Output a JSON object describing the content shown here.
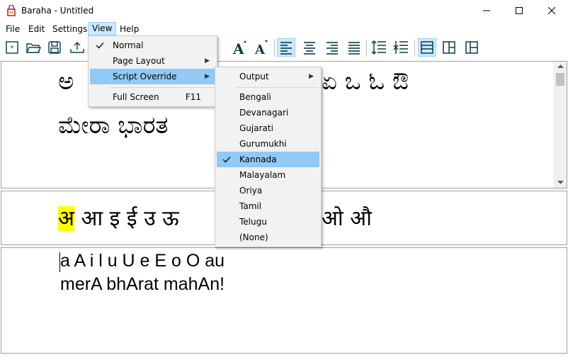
{
  "window": {
    "title": "Baraha - Untitled"
  },
  "menubar": {
    "items": [
      "File",
      "Edit",
      "Settings",
      "View",
      "Help"
    ]
  },
  "view_menu": {
    "items": [
      {
        "label": "Normal",
        "checked": true
      },
      {
        "label": "Page Layout",
        "submenu": true
      },
      {
        "label": "Script Override",
        "submenu": true,
        "highlighted": true
      },
      {
        "label": "Full Screen",
        "shortcut": "F11"
      }
    ]
  },
  "script_menu": {
    "output_label": "Output",
    "items": [
      "Bengali",
      "Devanagari",
      "Gujarati",
      "Gurumukhi",
      "Kannada",
      "Malayalam",
      "Oriya",
      "Tamil",
      "Telugu",
      "(None)"
    ],
    "checked": "Kannada"
  },
  "editor": {
    "top_line1_start": "ಅ",
    "top_line1_end": "ಏ ಒ ಓ ಔ",
    "top_line2": "ಮೇರಾ ಭಾರತ",
    "middle_first": "अ",
    "middle_rest": "आ इ ई उ ऊ",
    "middle_end": "ओ औ",
    "input_line1": "a A i l u U e E o O au",
    "input_line2": "merA bhArat mahAn!"
  },
  "icons": [
    "new-doc-icon",
    "open-folder-icon",
    "save-icon",
    "export-icon",
    "font-bigger-icon",
    "font-smaller-icon",
    "align-left-icon",
    "align-center-icon",
    "align-right-icon",
    "align-justify-icon",
    "line-spacing-up-icon",
    "line-spacing-down-icon",
    "pane-horizontal-icon",
    "pane-two-icon",
    "pane-split-icon"
  ],
  "colors": {
    "highlight": "#ffff00",
    "menu_hover": "#91c9f7",
    "selected": "#cce8ff"
  }
}
